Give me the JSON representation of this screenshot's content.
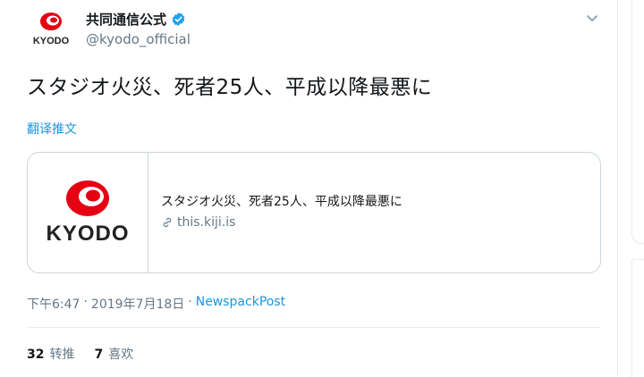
{
  "author": {
    "name": "共同通信公式",
    "handle": "@kyodo_official",
    "logo_text": "KYODO",
    "verified_color": "#1da1f2"
  },
  "tweet": {
    "text": "スタジオ火災、死者25人、平成以降最悪に",
    "translate_label": "翻译推文"
  },
  "card": {
    "logo_text": "KYODO",
    "title": "スタジオ火災、死者25人、平成以降最悪に",
    "domain": "this.kiji.is"
  },
  "meta": {
    "time": "下午6:47",
    "separator1": "·",
    "date": "2019年7月18日",
    "separator2": "·",
    "source": "NewspackPost"
  },
  "stats": {
    "retweets_count": "32",
    "retweets_label": "转推",
    "likes_count": "7",
    "likes_label": "喜欢"
  },
  "colors": {
    "brand_red": "#e50012",
    "link_blue": "#1b95e0",
    "secondary_text": "#657786"
  }
}
